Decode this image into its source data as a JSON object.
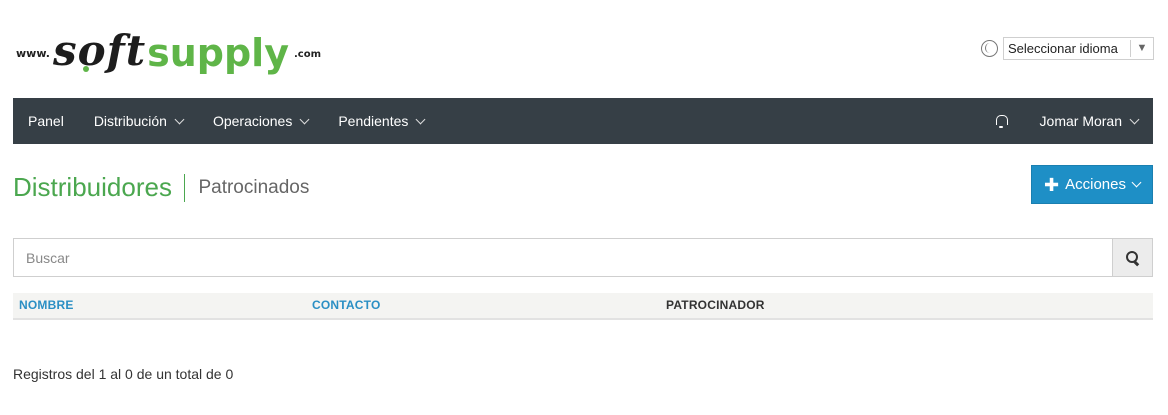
{
  "header": {
    "logo": {
      "www": "www.",
      "soft": "soft",
      "supply": "supply",
      "com": ".com",
      "brand_green": "#5fb548"
    },
    "language": {
      "icon": "globe-icon",
      "selected": "Seleccionar idioma",
      "arrow": "▼"
    }
  },
  "nav": {
    "background": "#363f46",
    "items": [
      {
        "label": "Panel",
        "dropdown": false
      },
      {
        "label": "Distribución",
        "dropdown": true
      },
      {
        "label": "Operaciones",
        "dropdown": true
      },
      {
        "label": "Pendientes",
        "dropdown": true
      }
    ],
    "notifications_icon": "bell-icon",
    "user": {
      "label": "Jomar Moran",
      "dropdown": true
    }
  },
  "page": {
    "title": "Distribuidores",
    "subtitle": "Patrocinados",
    "title_color": "#4ba74f",
    "actions": {
      "label": "Acciones",
      "icon": "plus-icon",
      "color": "#1e8fc6"
    }
  },
  "search": {
    "placeholder": "Buscar",
    "value": "",
    "icon": "search-icon"
  },
  "table": {
    "columns": [
      {
        "label": "NOMBRE",
        "sortable": true
      },
      {
        "label": "CONTACTO",
        "sortable": true
      },
      {
        "label": "PATROCINADOR",
        "sortable": false
      }
    ],
    "rows": []
  },
  "footer": {
    "records_text": "Registros del 1 al 0 de un total de 0"
  }
}
